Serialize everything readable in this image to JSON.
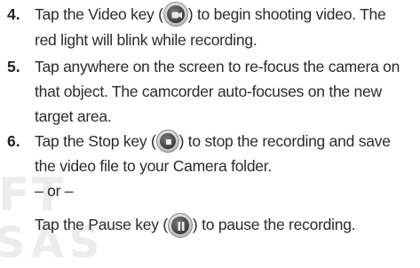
{
  "steps": [
    {
      "number": "4.",
      "line1_before": "Tap the Video key (",
      "line1_after": ") to begin shooting video. The",
      "line2": "red light will blink while recording.",
      "icon": "video-camera-icon"
    },
    {
      "number": "5.",
      "line1": "Tap anywhere on the screen to re-focus the camera on",
      "line2": "that object. The camcorder auto-focuses on the new",
      "line3": "target area."
    },
    {
      "number": "6.",
      "line1_before": "Tap the Stop key (",
      "line1_after": ") to stop the recording and save",
      "line2": "the video file to your Camera folder.",
      "icon": "stop-icon",
      "or_text": "– or –",
      "alt_before": "Tap the Pause key (",
      "alt_after": ") to pause the recording.",
      "alt_icon": "pause-icon"
    }
  ]
}
